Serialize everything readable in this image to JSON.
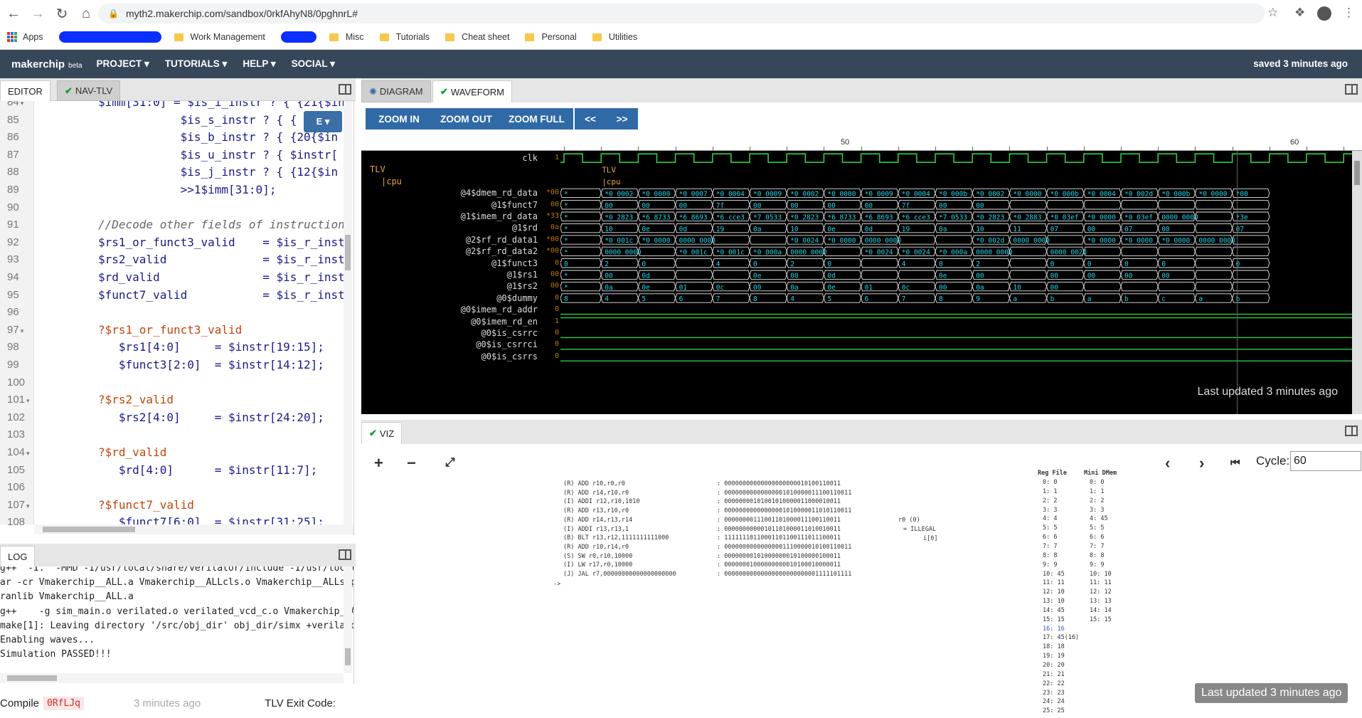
{
  "browser": {
    "url": "myth2.makerchip.com/sandbox/0rkfAhyN8/0pghnrL#",
    "bookmarks": [
      "Apps",
      "Work Management",
      "Misc",
      "Tutorials",
      "Cheat sheet",
      "Personal",
      "Utilities"
    ]
  },
  "app": {
    "logo": "makerchip",
    "beta": "beta",
    "menus": [
      "PROJECT ▾",
      "TUTORIALS ▾",
      "HELP ▾",
      "SOCIAL ▾"
    ],
    "saved": "saved 3 minutes ago"
  },
  "editor": {
    "tabs": [
      "EDITOR",
      "NAV-TLV"
    ],
    "dropdown": "E ▾",
    "line_numbers": [
      "84",
      "85",
      "86",
      "87",
      "88",
      "89",
      "90",
      "91",
      "92",
      "93",
      "94",
      "95",
      "96",
      "97",
      "98",
      "99",
      "100",
      "101",
      "102",
      "103",
      "104",
      "105",
      "106",
      "107",
      "108",
      "109"
    ],
    "lines": [
      {
        "n": "84",
        "t": "$imm[31:0] = $is_i_instr ? { {21{$in",
        "c": "cd"
      },
      {
        "n": "85",
        "t": "            $is_s_instr ? { {",
        "c": "cd"
      },
      {
        "n": "86",
        "t": "            $is_b_instr ? { {20{$in",
        "c": "cd"
      },
      {
        "n": "87",
        "t": "            $is_u_instr ? { $instr[",
        "c": "cd"
      },
      {
        "n": "88",
        "t": "            $is_j_instr ? { {12{$in",
        "c": "cd"
      },
      {
        "n": "89",
        "t": "            >>1$imm[31:0];",
        "c": "cd"
      },
      {
        "n": "90",
        "t": "",
        "c": "cd"
      },
      {
        "n": "91",
        "t": "//Decode other fields of instruction",
        "c": "cc"
      },
      {
        "n": "92",
        "t": "$rs1_or_funct3_valid    = $is_r_inst",
        "c": "cd"
      },
      {
        "n": "93",
        "t": "$rs2_valid              = $is_r_inst",
        "c": "cd"
      },
      {
        "n": "94",
        "t": "$rd_valid               = $is_r_inst",
        "c": "cd"
      },
      {
        "n": "95",
        "t": "$funct7_valid           = $is_r_inst",
        "c": "cd"
      },
      {
        "n": "96",
        "t": "",
        "c": "cd"
      },
      {
        "n": "97",
        "t": "?$rs1_or_funct3_valid",
        "c": "cp"
      },
      {
        "n": "98",
        "t": "   $rs1[4:0]     = $instr[19:15];",
        "c": "cd"
      },
      {
        "n": "99",
        "t": "   $funct3[2:0]  = $instr[14:12];",
        "c": "cd"
      },
      {
        "n": "100",
        "t": "",
        "c": "cd"
      },
      {
        "n": "101",
        "t": "?$rs2_valid",
        "c": "cp"
      },
      {
        "n": "102",
        "t": "   $rs2[4:0]     = $instr[24:20];",
        "c": "cd"
      },
      {
        "n": "103",
        "t": "",
        "c": "cd"
      },
      {
        "n": "104",
        "t": "?$rd_valid",
        "c": "cp"
      },
      {
        "n": "105",
        "t": "   $rd[4:0]      = $instr[11:7];",
        "c": "cd"
      },
      {
        "n": "106",
        "t": "",
        "c": "cd"
      },
      {
        "n": "107",
        "t": "?$funct7_valid",
        "c": "cp"
      },
      {
        "n": "108",
        "t": "   $funct7[6:0]  = $instr[31:25];",
        "c": "cd"
      },
      {
        "n": "109",
        "t": "",
        "c": "cd"
      }
    ]
  },
  "log": {
    "tab": "LOG",
    "lines": [
      "g++  -I.  -MMD -I/usr/local/share/verilator/include -I/usr/local/",
      "ar -cr Vmakerchip__ALL.a Vmakerchip__ALLcls.o Vmakerchip__ALLsup",
      "ranlib Vmakerchip__ALL.a",
      "g++    -g sim_main.o verilated.o verilated_vcd_c.o Vmakerchip__Al",
      "make[1]: Leaving directory '/src/obj_dir' obj_dir/simx +verilator",
      "Enabling waves...",
      "Simulation PASSED!!!"
    ],
    "compile_label": "Compile",
    "compile_id": "0RfLJq",
    "compile_ago": "3 minutes ago",
    "exit_label": "TLV Exit Code:"
  },
  "waveform": {
    "tabs": [
      "DIAGRAM",
      "WAVEFORM"
    ],
    "buttons": [
      "ZOOM IN",
      "ZOOM OUT",
      "ZOOM FULL",
      "<<",
      ">>"
    ],
    "ruler_labels": [
      "50",
      "60"
    ],
    "last_updated": "Last updated 3 minutes ago",
    "signals": [
      {
        "name": "clk",
        "val": "1"
      },
      {
        "name": "TLV",
        "val": ""
      },
      {
        "name": "|cpu",
        "val": ""
      },
      {
        "name": "@4$dmem_rd_data",
        "val": "*00"
      },
      {
        "name": "@1$funct7",
        "val": "00"
      },
      {
        "name": "@1$imem_rd_data",
        "val": "*33"
      },
      {
        "name": "@1$rd",
        "val": "0a"
      },
      {
        "name": "@2$rf_rd_data1",
        "val": "*00"
      },
      {
        "name": "@2$rf_rd_data2",
        "val": "*00"
      },
      {
        "name": "@1$funct3",
        "val": "0"
      },
      {
        "name": "@1$rs1",
        "val": "00"
      },
      {
        "name": "@1$rs2",
        "val": "00"
      },
      {
        "name": "@0$dummy",
        "val": "0"
      },
      {
        "name": "@0$imem_rd_addr",
        "val": "0"
      },
      {
        "name": "@0$imem_rd_en",
        "val": "1"
      },
      {
        "name": "@0$is_csrrc",
        "val": "0"
      },
      {
        "name": "@0$is_csrrci",
        "val": "0"
      },
      {
        "name": "@0$is_csrrs",
        "val": "0"
      }
    ],
    "scope_labels": [
      "TLV",
      "|cpu"
    ],
    "bus_rows": [
      [
        "*",
        "*0_0002",
        "*0_0000",
        "*0_0007",
        "*0_0004",
        "*0_0009",
        "*0_0002",
        "*0_0000",
        "*0_0009",
        "*0_0004",
        "*0_000b",
        "*0_0002",
        "*0_0000",
        "*0_000b",
        "*0_0004",
        "*0_002d",
        "*0_000b",
        "*0_0000",
        "*00"
      ],
      [
        "*",
        "00",
        "00",
        "00",
        "7f",
        "00",
        "00",
        "00",
        "00",
        "7f",
        "00",
        "00",
        "",
        "",
        "",
        "",
        "",
        "",
        ""
      ],
      [
        "*",
        "*0_2823",
        "*6_8733",
        "*6_8693",
        "*6_cce3",
        "*7_0533",
        "*0_2823",
        "*6_8733",
        "*6_8693",
        "*6_cce3",
        "*7_0533",
        "*0_2823",
        "*0_2883",
        "*0_03ef",
        "*0_0000",
        "*0_03ef",
        "0000_0000",
        "",
        "*3e"
      ],
      [
        "*",
        "10",
        "0e",
        "0d",
        "19",
        "0a",
        "10",
        "0e",
        "0d",
        "19",
        "0a",
        "10",
        "11",
        "07",
        "00",
        "07",
        "00",
        "",
        "07"
      ],
      [
        "*",
        "*0_001c",
        "*0_0000",
        "0000_0008",
        "",
        "",
        "*0_0024",
        "*0_0000",
        "0000_0009",
        "",
        "",
        "*0_002d",
        "0000_0000",
        "",
        "*0_0000",
        "*0_0000",
        "*0_0000",
        "0000_0000",
        ""
      ],
      [
        "*",
        "0000_0000",
        "",
        "*0_001c",
        "*0_001c",
        "*0_000a",
        "0000_0000",
        "",
        "*0_0024",
        "*0_0024",
        "*0_000a",
        "0000_0000",
        "",
        "0000_002d",
        "",
        "",
        "",
        "",
        ""
      ],
      [
        "0",
        "2",
        "0",
        "",
        "4",
        "0",
        "2",
        "0",
        "",
        "4",
        "0",
        "2",
        "",
        "0",
        "0",
        "0",
        "0",
        "",
        "0"
      ],
      [
        "*",
        "00",
        "0d",
        "",
        "",
        "0e",
        "00",
        "0d",
        "",
        "",
        "0e",
        "00",
        "",
        "00",
        "00",
        "00",
        "00",
        "",
        ""
      ],
      [
        "*",
        "0a",
        "0e",
        "01",
        "0c",
        "00",
        "0a",
        "0e",
        "01",
        "0c",
        "00",
        "0a",
        "10",
        "00",
        "",
        "",
        "",
        "",
        ""
      ],
      [
        "8",
        "4",
        "5",
        "6",
        "7",
        "8",
        "4",
        "5",
        "6",
        "7",
        "8",
        "9",
        "a",
        "b",
        "a",
        "b",
        "c",
        "a",
        "b"
      ]
    ]
  },
  "viz": {
    "tab": "VIZ",
    "cycle_label": "Cycle:",
    "cycle_value": "60",
    "last_updated": "Last updated 3 minutes ago",
    "instructions": [
      {
        "asm": "(R) ADD r10,r0,r0",
        "bin": ": 00000000000000000000010100110011"
      },
      {
        "asm": "(R) ADD r14,r10,r0",
        "bin": ": 00000000000000001010000011100110011"
      },
      {
        "asm": "(I) ADDI r12,r10,1010",
        "bin": ": 00000000101001010000011000010011"
      },
      {
        "asm": "(R) ADD r13,r10,r0",
        "bin": ": 00000000000000001010000011010110011"
      },
      {
        "asm": "(R) ADD r14,r13,r14",
        "bin": ": 00000000111001101000011100110011"
      },
      {
        "asm": "(I) ADDI r13,r13,1",
        "bin": ": 00000000000101101000011010010011"
      },
      {
        "asm": "(B) BLT r13,r12,1111111111000",
        "bin": ": 11111110110001101100111011100011"
      },
      {
        "asm": "(R) ADD r10,r14,r0",
        "bin": ": 00000000000000001110000010100110011"
      },
      {
        "asm": "(S) SW r0,r10,10000",
        "bin": ": 00000000101000000010100000100011"
      },
      {
        "asm": "(I) LW r17,r0,10000",
        "bin": ": 00000001000000000010100010000011"
      },
      {
        "asm": "(J) JAL r7,00000000000000000000",
        "bin": ": 00000000000000000000000001111101111"
      }
    ],
    "arrow": "->",
    "note": [
      "r0 (0)",
      "= ILLEGAL",
      "i[0]"
    ],
    "regfile_title": "Reg File",
    "dmem_title": "Mini DMem",
    "regfile": [
      "0: 0",
      "1: 1",
      "2: 2",
      "3: 3",
      "4: 4",
      "5: 5",
      "6: 6",
      "7: 7",
      "8: 8",
      "9: 9",
      "10: 45",
      "11: 11",
      "12: 10",
      "13: 10",
      "14: 45",
      "15: 15",
      "16: 16",
      "17: 45(16)",
      "18: 18",
      "19: 19",
      "20: 20",
      "21: 21",
      "22: 22",
      "23: 23",
      "24: 24",
      "25: 25"
    ],
    "dmem": [
      "0: 0",
      "1: 1",
      "2: 2",
      "3: 3",
      "4: 45",
      "5: 5",
      "6: 6",
      "7: 7",
      "8: 8",
      "9: 9",
      "10: 10",
      "11: 11",
      "12: 12",
      "13: 13",
      "14: 14",
      "15: 15"
    ]
  },
  "colors": {
    "appbar": "#37475a",
    "button": "#2f6aa6",
    "wave_green": "#2ecc40",
    "wave_cyan": "#1fd5e8",
    "check": "#0a9f2c"
  }
}
